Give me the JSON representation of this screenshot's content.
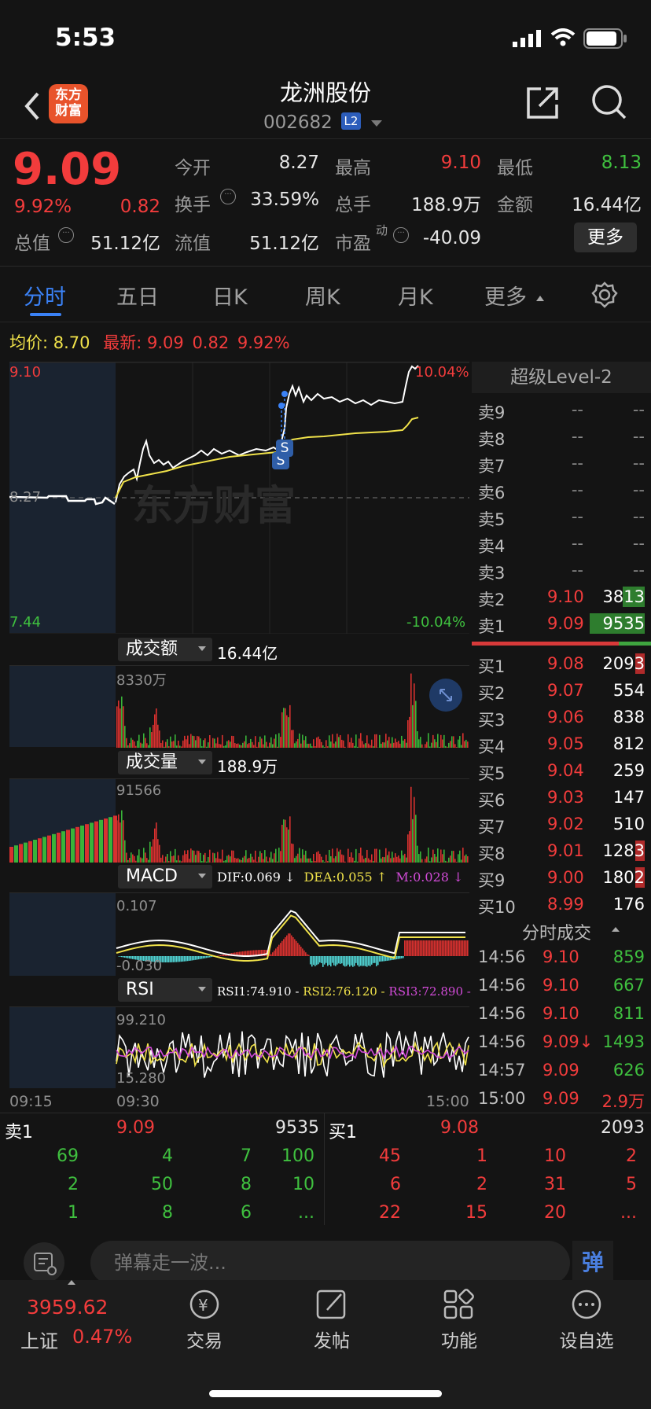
{
  "status_bar": {
    "time": "5:53"
  },
  "nav": {
    "logo_text_line1": "东方",
    "logo_text_line2": "财富",
    "stock_name": "龙洲股份",
    "stock_code": "002682",
    "level_badge": "L2"
  },
  "quote": {
    "price": "9.09",
    "change_pct": "9.92%",
    "change": "0.82",
    "open_label": "今开",
    "open": "8.27",
    "high_label": "最高",
    "high": "9.10",
    "low_label": "最低",
    "low": "8.13",
    "turnover_label": "换手",
    "turnover": "33.59%",
    "volume_label": "总手",
    "volume": "188.9万",
    "amount_label": "金额",
    "amount": "16.44亿",
    "mcap_label": "总值",
    "mcap": "51.12亿",
    "float_label": "流值",
    "float": "51.12亿",
    "pe_label": "市盈",
    "pe_sup": "动",
    "pe": "-40.09",
    "more_button": "更多"
  },
  "tabs": [
    {
      "label": "分时",
      "active": true
    },
    {
      "label": "五日"
    },
    {
      "label": "日K"
    },
    {
      "label": "周K"
    },
    {
      "label": "月K"
    },
    {
      "label": "更多"
    }
  ],
  "summary": {
    "avg_label": "均价:",
    "avg": "8.70",
    "latest_label": "最新:",
    "latest": "9.09",
    "latest_change": "0.82",
    "latest_pct": "9.92%"
  },
  "price_chart": {
    "top_price": "9.10",
    "top_pct": "10.04%",
    "base_price": "8.27",
    "bottom_price": "7.44",
    "bottom_pct": "-10.04%",
    "watermark": "东方财富",
    "marker": "S"
  },
  "amount_panel": {
    "selector": "成交额",
    "total": "16.44亿",
    "max_label": "8330万"
  },
  "volume_panel": {
    "selector": "成交量",
    "total": "188.9万",
    "max_label": "91566"
  },
  "macd_panel": {
    "selector": "MACD",
    "dif": "DIF:0.069 ↓",
    "dea": "DEA:0.055 ↑",
    "m": "M:0.028 ↓",
    "max_label": "0.107",
    "min_label": "-0.030"
  },
  "rsi_panel": {
    "selector": "RSI",
    "rsi1": "RSI1:74.910 -",
    "rsi2": "RSI2:76.120 -",
    "rsi3": "RSI3:72.890 -",
    "max_label": "99.210",
    "min_label": "15.280"
  },
  "time_axis": {
    "t1": "09:15",
    "t2": "09:30",
    "t3": "15:00"
  },
  "order_book": {
    "title": "超级Level-2",
    "asks": [
      {
        "label": "卖9",
        "price": "--",
        "vol": "--"
      },
      {
        "label": "卖8",
        "price": "--",
        "vol": "--"
      },
      {
        "label": "卖7",
        "price": "--",
        "vol": "--"
      },
      {
        "label": "卖6",
        "price": "--",
        "vol": "--"
      },
      {
        "label": "卖5",
        "price": "--",
        "vol": "--"
      },
      {
        "label": "卖4",
        "price": "--",
        "vol": "--"
      },
      {
        "label": "卖3",
        "price": "--",
        "vol": "--"
      },
      {
        "label": "卖2",
        "price": "9.10",
        "vol": "3813"
      },
      {
        "label": "卖1",
        "price": "9.09",
        "vol": "9535"
      }
    ],
    "bids": [
      {
        "label": "买1",
        "price": "9.08",
        "vol": "2093"
      },
      {
        "label": "买2",
        "price": "9.07",
        "vol": "554"
      },
      {
        "label": "买3",
        "price": "9.06",
        "vol": "838"
      },
      {
        "label": "买4",
        "price": "9.05",
        "vol": "812"
      },
      {
        "label": "买5",
        "price": "9.04",
        "vol": "259"
      },
      {
        "label": "买6",
        "price": "9.03",
        "vol": "147"
      },
      {
        "label": "买7",
        "price": "9.02",
        "vol": "510"
      },
      {
        "label": "买8",
        "price": "9.01",
        "vol": "1283"
      },
      {
        "label": "买9",
        "price": "9.00",
        "vol": "1802"
      },
      {
        "label": "买10",
        "price": "8.99",
        "vol": "176"
      }
    ],
    "trades_title": "分时成交",
    "trades": [
      {
        "time": "14:56",
        "price": "9.10",
        "vol": "859"
      },
      {
        "time": "14:56",
        "price": "9.10",
        "vol": "667"
      },
      {
        "time": "14:56",
        "price": "9.10",
        "vol": "811"
      },
      {
        "time": "14:56",
        "price": "9.09↓",
        "vol": "1493"
      },
      {
        "time": "14:57",
        "price": "9.09",
        "vol": "626"
      },
      {
        "time": "15:00",
        "price": "9.09",
        "vol": "2.9万"
      }
    ]
  },
  "queue": {
    "sell_label": "卖1",
    "sell_price": "9.09",
    "sell_vol": "9535",
    "buy_label": "买1",
    "buy_price": "9.08",
    "buy_vol": "2093",
    "sell_rows": [
      [
        "69",
        "4",
        "7",
        "100"
      ],
      [
        "2",
        "50",
        "8",
        "10"
      ],
      [
        "1",
        "8",
        "6",
        "..."
      ]
    ],
    "buy_rows": [
      [
        "45",
        "1",
        "10",
        "2"
      ],
      [
        "6",
        "2",
        "31",
        "5"
      ],
      [
        "22",
        "15",
        "20",
        "..."
      ]
    ]
  },
  "comment": {
    "placeholder": "弹幕走一波...",
    "danmu_button": "弹"
  },
  "bottom_nav": {
    "index_value": "3959.62",
    "index_name": "上证",
    "index_pct": "0.47%",
    "trade": "交易",
    "post": "发帖",
    "features": "功能",
    "watchlist": "设自选"
  },
  "colors": {
    "up": "#f23c3c",
    "down": "#3fc03f",
    "avg_line": "#f0e24a",
    "accent": "#3b82f6"
  }
}
